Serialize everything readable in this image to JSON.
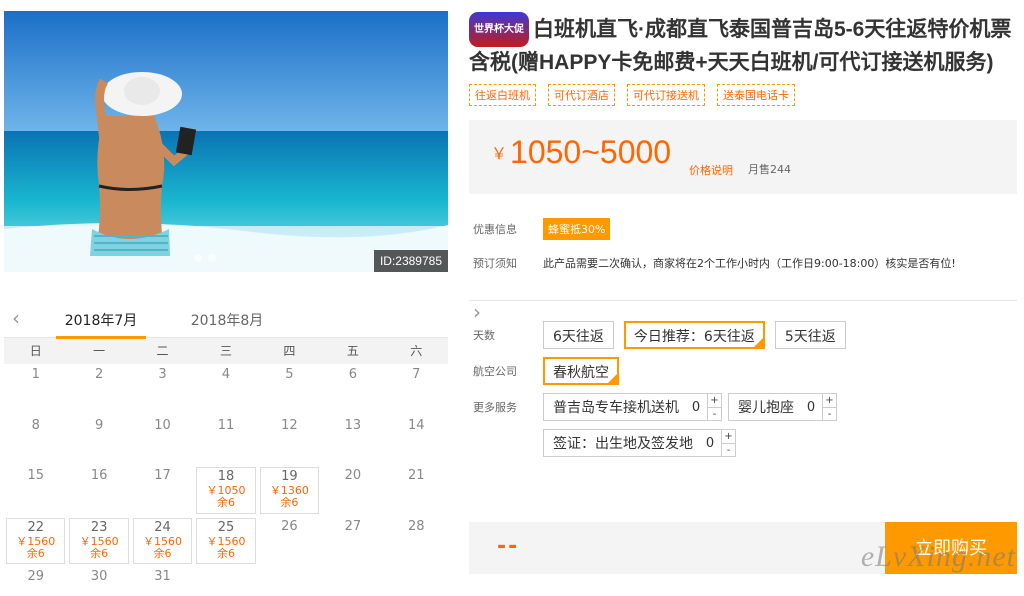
{
  "hero": {
    "id_label": "ID:2389785"
  },
  "calendar": {
    "months": [
      "2018年7月",
      "2018年8月"
    ],
    "weekdays": [
      "日",
      "一",
      "二",
      "三",
      "四",
      "五",
      "六"
    ],
    "days": [
      {
        "d": "1"
      },
      {
        "d": "2"
      },
      {
        "d": "3"
      },
      {
        "d": "4"
      },
      {
        "d": "5"
      },
      {
        "d": "6"
      },
      {
        "d": "7"
      },
      {
        "d": "8"
      },
      {
        "d": "9"
      },
      {
        "d": "10"
      },
      {
        "d": "11"
      },
      {
        "d": "12"
      },
      {
        "d": "13"
      },
      {
        "d": "14"
      },
      {
        "d": "15"
      },
      {
        "d": "16"
      },
      {
        "d": "17"
      },
      {
        "d": "18",
        "p": "￥1050",
        "r": "余6"
      },
      {
        "d": "19",
        "p": "￥1360",
        "r": "余6"
      },
      {
        "d": "20"
      },
      {
        "d": "21"
      },
      {
        "d": "22",
        "p": "￥1560",
        "r": "余6"
      },
      {
        "d": "23",
        "p": "￥1560",
        "r": "余6"
      },
      {
        "d": "24",
        "p": "￥1560",
        "r": "余6"
      },
      {
        "d": "25",
        "p": "￥1560",
        "r": "余6"
      },
      {
        "d": "26"
      },
      {
        "d": "27"
      },
      {
        "d": "28"
      },
      {
        "d": "29"
      },
      {
        "d": "30"
      },
      {
        "d": "31"
      }
    ]
  },
  "product": {
    "badge": "世界杯大促",
    "title": "白班机直飞·成都直飞泰国普吉岛5-6天往返特价机票含税(赠HAPPY卡免邮费+天天白班机/可代订接送机服务)",
    "tags": [
      "往返白班机",
      "可代订酒店",
      "可代订接送机",
      "送泰国电话卡"
    ],
    "price_currency": "￥",
    "price_value": "1050~5000",
    "price_explain": "价格说明",
    "monthly_sales": "月售244"
  },
  "info": {
    "promo_label": "优惠信息",
    "promo_value": "蜂蜜抵30%",
    "notice_label": "预订须知",
    "notice_value": "此产品需要二次确认，商家将在2个工作小时内（工作日9:00-18:00）核实是否有位!"
  },
  "options": {
    "days_label": "天数",
    "days": [
      "6天往返",
      "今日推荐：6天往返",
      "5天往返"
    ],
    "airline_label": "航空公司",
    "airline": "春秋航空",
    "services_label": "更多服务",
    "services": [
      {
        "name": "普吉岛专车接机送机",
        "qty": "0"
      },
      {
        "name": "婴儿抱座",
        "qty": "0"
      },
      {
        "name": "签证：出生地及签发地",
        "qty": "0"
      }
    ],
    "plus": "+",
    "minus": "-"
  },
  "buy": {
    "total": "--",
    "button": "立即购买"
  },
  "watermark": "eLvXing.net"
}
